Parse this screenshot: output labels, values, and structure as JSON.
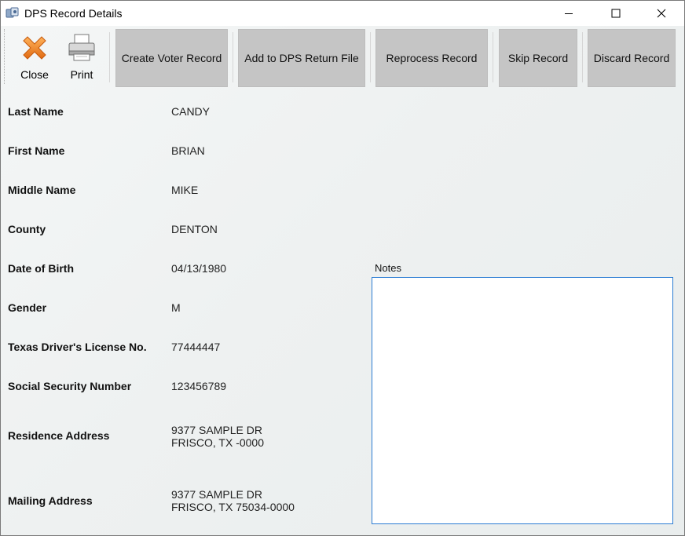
{
  "window": {
    "title": "DPS Record Details",
    "icon": "record-app-icon"
  },
  "toolbar": {
    "close_label": "Close",
    "print_label": "Print",
    "actions": {
      "create_voter": "Create Voter Record",
      "add_return": "Add to DPS Return File",
      "reprocess": "Reprocess Record",
      "skip": "Skip Record",
      "discard": "Discard Record"
    }
  },
  "fields": {
    "last_name": {
      "label": "Last Name",
      "value": "CANDY"
    },
    "first_name": {
      "label": "First Name",
      "value": "BRIAN"
    },
    "middle_name": {
      "label": "Middle Name",
      "value": "MIKE"
    },
    "county": {
      "label": "County",
      "value": "DENTON"
    },
    "dob": {
      "label": "Date of Birth",
      "value": "04/13/1980"
    },
    "gender": {
      "label": "Gender",
      "value": "M"
    },
    "dl": {
      "label": "Texas Driver's License No.",
      "value": "77444447"
    },
    "ssn": {
      "label": "Social Security Number",
      "value": "123456789"
    },
    "residence": {
      "label": "Residence Address",
      "line1": "9377 SAMPLE DR",
      "line2": "FRISCO, TX -0000"
    },
    "mailing": {
      "label": "Mailing Address",
      "line1": "9377 SAMPLE DR",
      "line2": "FRISCO, TX 75034-0000"
    }
  },
  "notes": {
    "label": "Notes",
    "value": ""
  },
  "colors": {
    "action_button_bg": "#c5c5c5",
    "notes_border": "#2b7cd3",
    "close_icon": "#f08a24"
  }
}
